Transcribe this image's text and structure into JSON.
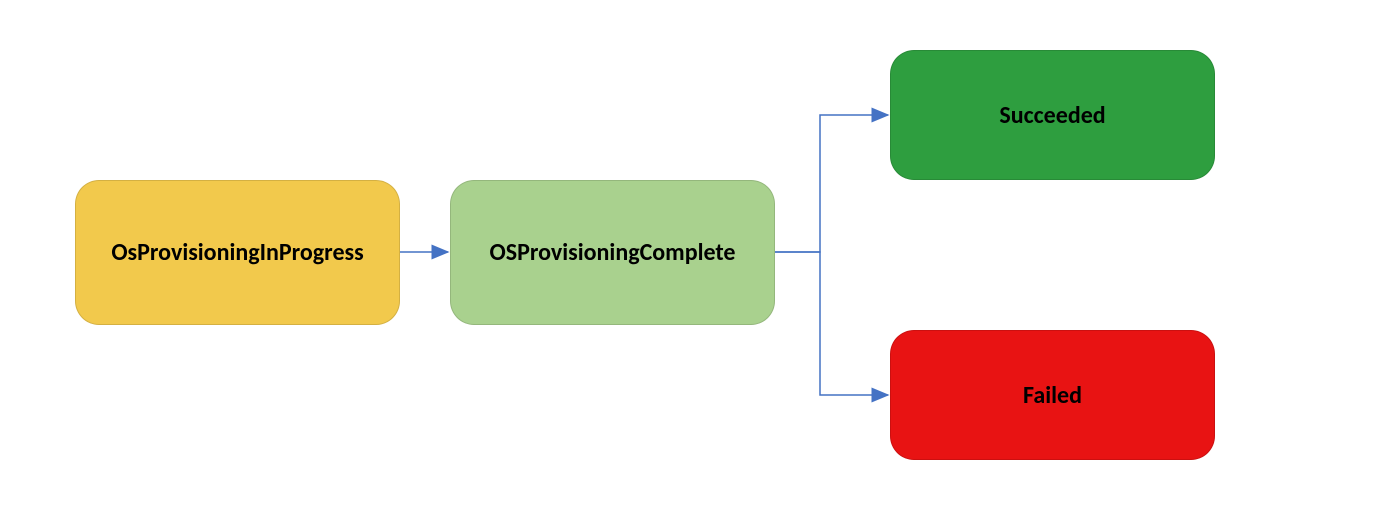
{
  "nodes": {
    "inprogress": {
      "label": "OsProvisioningInProgress",
      "color": "#f2c94c"
    },
    "complete": {
      "label": "OSProvisioningComplete",
      "color": "#a9d18e"
    },
    "succeeded": {
      "label": "Succeeded",
      "color": "#2e9e3f"
    },
    "failed": {
      "label": "Failed",
      "color": "#e81313"
    }
  },
  "edges": [
    {
      "from": "inprogress",
      "to": "complete"
    },
    {
      "from": "complete",
      "to": "succeeded"
    },
    {
      "from": "complete",
      "to": "failed"
    }
  ],
  "arrow_color": "#4472c4"
}
